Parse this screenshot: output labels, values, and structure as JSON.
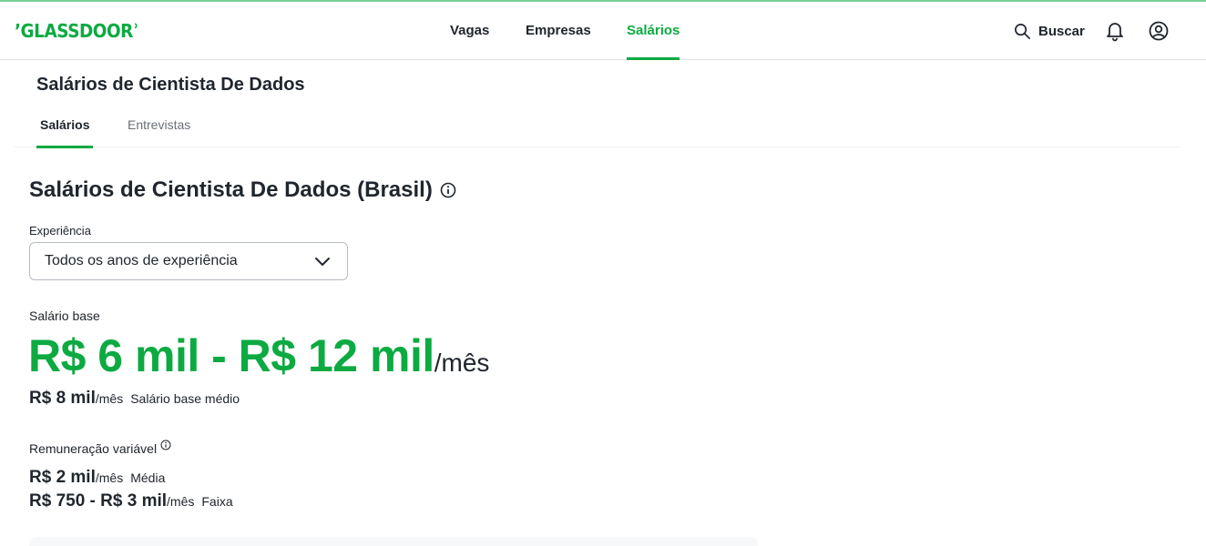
{
  "brand": {
    "logo_text": "GLASSDOOR",
    "accent": "#0caa41"
  },
  "nav": {
    "items": [
      {
        "label": "Vagas",
        "active": false
      },
      {
        "label": "Empresas",
        "active": false
      },
      {
        "label": "Salários",
        "active": true
      }
    ],
    "search_label": "Buscar",
    "icons": [
      "search-icon",
      "bell-icon",
      "user-icon"
    ]
  },
  "page": {
    "title": "Salários de Cientista De Dados",
    "tabs": [
      {
        "label": "Salários",
        "active": true
      },
      {
        "label": "Entrevistas",
        "active": false
      }
    ]
  },
  "salary": {
    "section_title": "Salários de Cientista De Dados (Brasil)",
    "experience_label": "Experiência",
    "experience_value": "Todos os anos de experiência",
    "base_label": "Salário base",
    "base_range": "R$ 6 mil - R$ 12 mil",
    "base_period": "/mês",
    "median_value": "R$ 8 mil",
    "median_period": "/mês",
    "median_desc": "Salário base médio",
    "variable_label": "Remuneração variável",
    "variable_avg_value": "R$ 2 mil",
    "variable_avg_period": "/mês",
    "variable_avg_desc": "Média",
    "variable_range_value": "R$ 750 - R$ 3 mil",
    "variable_range_period": "/mês",
    "variable_range_desc": "Faixa"
  }
}
